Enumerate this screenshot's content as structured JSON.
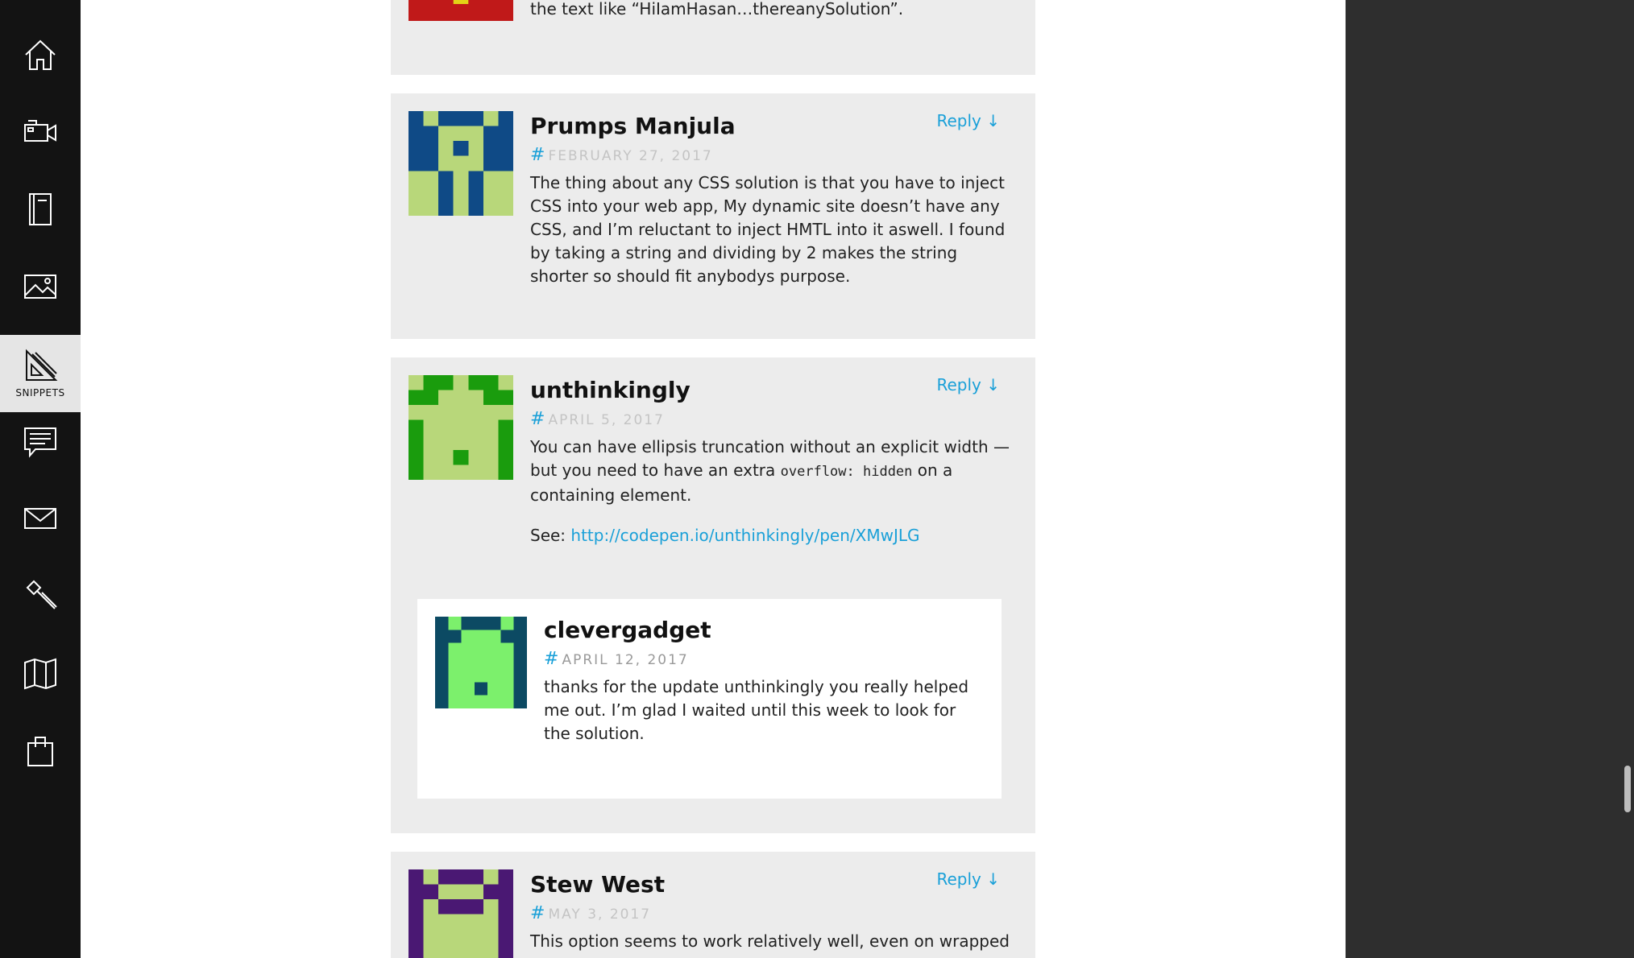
{
  "sidebar": {
    "items": [
      {
        "icon": "home-icon",
        "label": ""
      },
      {
        "icon": "video-camera-icon",
        "label": ""
      },
      {
        "icon": "notebook-icon",
        "label": ""
      },
      {
        "icon": "image-icon",
        "label": ""
      },
      {
        "icon": "snippets-icon",
        "label": "SNIPPETS",
        "active": true
      },
      {
        "icon": "forum-icon",
        "label": ""
      },
      {
        "icon": "mail-icon",
        "label": ""
      },
      {
        "icon": "hammer-icon",
        "label": ""
      },
      {
        "icon": "map-icon",
        "label": ""
      },
      {
        "icon": "shopping-bag-icon",
        "label": ""
      }
    ]
  },
  "comments": {
    "partial": {
      "body_tail": "the text like “HiIamHasan…thereanySolution”.",
      "avatar_color": "#c01919"
    },
    "c1": {
      "author": "Prumps Manjula",
      "hash": "#",
      "date": "FEBRUARY 27, 2017",
      "reply": "Reply ↓",
      "body": "The thing about any CSS solution is that you have to inject CSS into your web app, My dynamic site doesn’t have any CSS, and I’m reluctant to inject HMTL into it aswell. I found by taking a string and dividing by 2 makes the string shorter so should fit anybodys purpose.",
      "avatar_bg": "#0f4a86",
      "avatar_fg": "#b8d77a"
    },
    "c2": {
      "author": "unthinkingly",
      "hash": "#",
      "date": "APRIL 5, 2017",
      "reply": "Reply ↓",
      "body_before": "You can have ellipsis truncation without an explicit width — but you need to have an extra ",
      "body_code": "overflow: hidden",
      "body_after": " on a containing element.",
      "see_label": "See: ",
      "see_link": "http://codepen.io/unthinkingly/pen/XMwJLG",
      "avatar_bg": "#1a9c0d",
      "avatar_fg": "#b8d77a"
    },
    "c3": {
      "author": "clevergadget",
      "hash": "#",
      "date": "APRIL 12, 2017",
      "body": "thanks for the update unthinkingly you really helped me out. I’m glad I waited until this week to look for the solution.",
      "avatar_bg": "#0c4a63",
      "avatar_fg": "#7cf06c"
    },
    "c4": {
      "author": "Stew West",
      "hash": "#",
      "date": "MAY 3, 2017",
      "reply": "Reply ↓",
      "body": "This option seems to work relatively well, even on wrapped",
      "avatar_bg": "#4a1873",
      "avatar_fg": "#b8d77a"
    }
  }
}
